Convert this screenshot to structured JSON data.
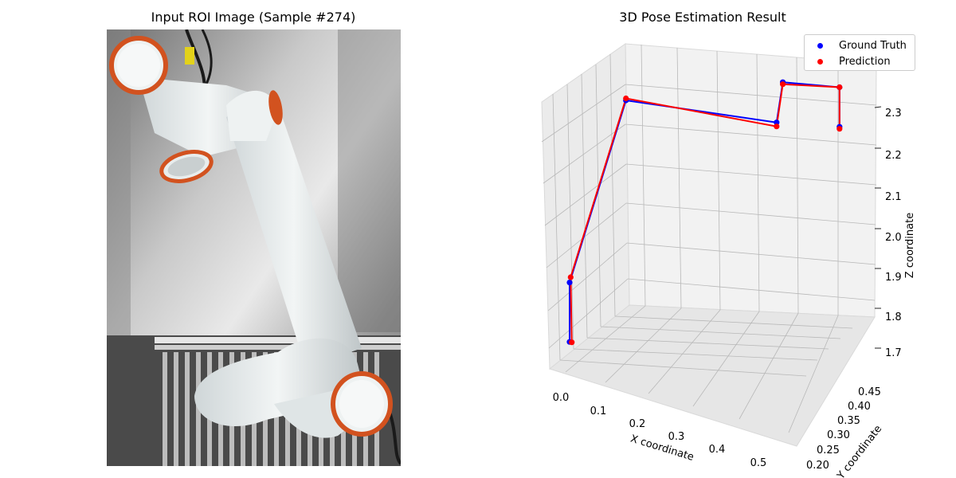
{
  "left_panel": {
    "title": "Input ROI Image (Sample #274)"
  },
  "right_panel": {
    "title": "3D Pose Estimation Result"
  },
  "chart_data": {
    "type": "scatter",
    "title": "3D Pose Estimation Result",
    "xlabel": "X coordinate",
    "ylabel": "Y coordinate",
    "zlabel": "Z coordinate",
    "x_ticks": [
      "0.0",
      "0.1",
      "0.2",
      "0.3",
      "0.4",
      "0.5"
    ],
    "y_ticks": [
      "0.20",
      "0.25",
      "0.30",
      "0.35",
      "0.40",
      "0.45"
    ],
    "z_ticks": [
      "1.7",
      "1.8",
      "1.9",
      "2.0",
      "2.1",
      "2.2",
      "2.3"
    ],
    "grid": true,
    "legend_position": "top-right",
    "series": [
      {
        "name": "Ground Truth",
        "color": "#0000ff",
        "points": [
          {
            "x": 0.02,
            "y": 0.2,
            "z": 1.7
          },
          {
            "x": 0.02,
            "y": 0.2,
            "z": 1.85
          },
          {
            "x": 0.1,
            "y": 0.3,
            "z": 2.26
          },
          {
            "x": 0.42,
            "y": 0.35,
            "z": 2.24
          },
          {
            "x": 0.4,
            "y": 0.42,
            "z": 2.29
          },
          {
            "x": 0.52,
            "y": 0.44,
            "z": 2.29
          },
          {
            "x": 0.52,
            "y": 0.44,
            "z": 2.19
          }
        ]
      },
      {
        "name": "Prediction",
        "color": "#ff0000",
        "points": [
          {
            "x": 0.025,
            "y": 0.2,
            "z": 1.7
          },
          {
            "x": 0.02,
            "y": 0.205,
            "z": 1.86
          },
          {
            "x": 0.1,
            "y": 0.3,
            "z": 2.265
          },
          {
            "x": 0.42,
            "y": 0.35,
            "z": 2.23
          },
          {
            "x": 0.4,
            "y": 0.42,
            "z": 2.285
          },
          {
            "x": 0.52,
            "y": 0.44,
            "z": 2.29
          },
          {
            "x": 0.52,
            "y": 0.44,
            "z": 2.185
          }
        ]
      }
    ]
  },
  "colors": {
    "ground_truth": "#0000ff",
    "prediction": "#ff0000",
    "pane": "#f2f2f2",
    "grid": "#b0b0b0"
  }
}
